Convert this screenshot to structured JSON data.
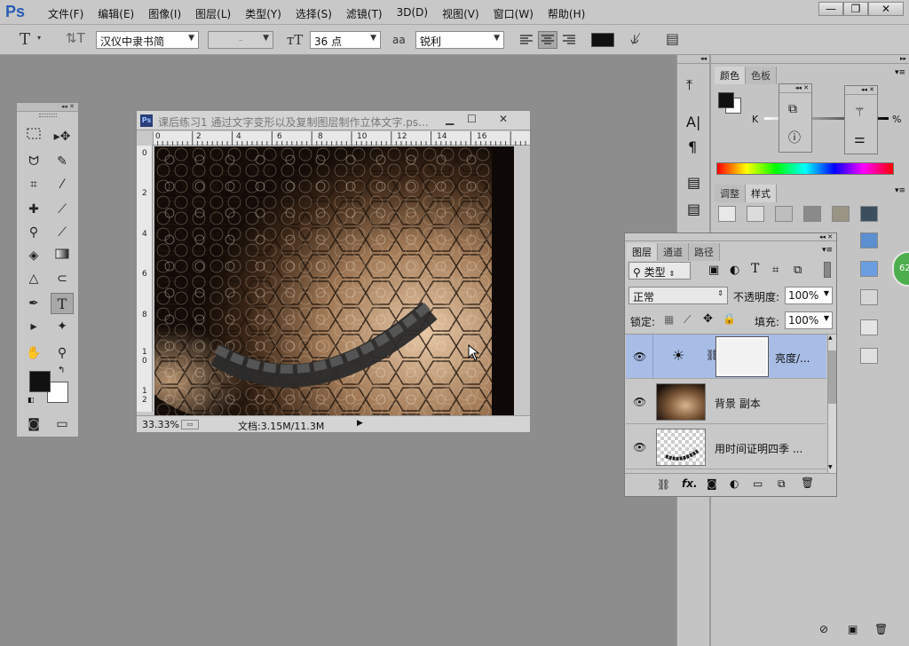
{
  "app": {
    "logo": "Ps",
    "menu": [
      "文件(F)",
      "编辑(E)",
      "图像(I)",
      "图层(L)",
      "类型(Y)",
      "选择(S)",
      "滤镜(T)",
      "3D(D)",
      "视图(V)",
      "窗口(W)",
      "帮助(H)"
    ]
  },
  "options": {
    "font_family": "汉仪中隶书简",
    "font_style": "-",
    "font_size": "36 点",
    "aa_label": "aa",
    "antialias": "锐利",
    "text_color": "#111111"
  },
  "document": {
    "title": "课后练习1 通过文字变形以及复制图层制作立体文字.ps...",
    "ps_icon": "Ps",
    "ruler_h": [
      "0",
      "2",
      "4",
      "6",
      "8",
      "10",
      "12",
      "14",
      "16"
    ],
    "ruler_v": [
      "0",
      "2",
      "4",
      "6",
      "8",
      "1\n0",
      "1\n2"
    ],
    "zoom": "33.33%",
    "doc_info": "文档:3.15M/11.3M"
  },
  "color_panel": {
    "tabs": [
      "颜色",
      "色板"
    ],
    "k_label": "K",
    "pct": "%"
  },
  "styles_panel": {
    "tabs": [
      "调整",
      "样式"
    ]
  },
  "layers_panel": {
    "tabs": [
      "图层",
      "通道",
      "路径"
    ],
    "filter_kind": "类型",
    "blend_mode": "正常",
    "opacity_label": "不透明度:",
    "opacity_value": "100%",
    "lock_label": "锁定:",
    "fill_label": "填充:",
    "fill_value": "100%",
    "layers": [
      {
        "name": "亮度/...",
        "selected": true
      },
      {
        "name": "背景 副本",
        "selected": false
      },
      {
        "name": "用时间证明四季 ...",
        "selected": false
      }
    ],
    "bottom_icons": [
      "link-icon",
      "fx-icon",
      "mask-icon",
      "adjustment-icon",
      "folder-icon",
      "new-layer-icon",
      "trash-icon"
    ],
    "fx_label": "fx."
  },
  "badge": "62",
  "colors": {
    "accent_selected": "#a8bde6",
    "foreground": "#111111",
    "background": "#ffffff"
  }
}
